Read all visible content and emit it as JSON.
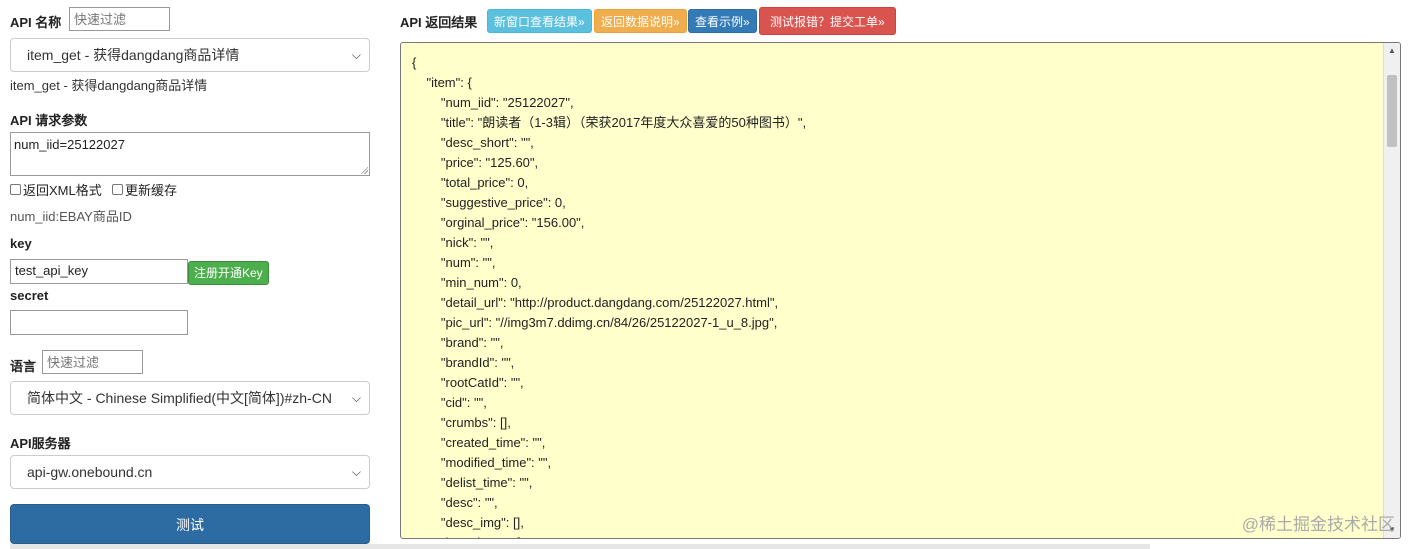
{
  "left": {
    "api_name_label": "API 名称",
    "api_filter_placeholder": "快速过滤",
    "api_selected": "item_get - 获得dangdang商品详情",
    "api_desc": "item_get - 获得dangdang商品详情",
    "params_label": "API 请求参数",
    "params_value": "num_iid=25122027",
    "xml_label": "返回XML格式",
    "cache_label": "更新缓存",
    "param_hint": "num_iid:EBAY商品ID",
    "key_label": "key",
    "key_value": "test_api_key",
    "register_button": "注册开通Key",
    "secret_label": "secret",
    "secret_value": "",
    "lang_label": "语言",
    "lang_filter_placeholder": "快速过滤",
    "lang_selected": "简体中文 - Chinese Simplified(中文[简体])#zh-CN",
    "server_label": "API服务器",
    "server_selected": "api-gw.onebound.cn",
    "test_button": "测试"
  },
  "right": {
    "title": "API 返回结果",
    "buttons": [
      {
        "label": "新窗口查看结果»",
        "color": "#5bc0de"
      },
      {
        "label": "返回数据说明»",
        "color": "#f0ad4e"
      },
      {
        "label": "查看示例»",
        "color": "#337ab7"
      },
      {
        "label": "测试报错？提交工单»",
        "color": "#d9534f"
      }
    ],
    "result_text": "{\n\t\"item\": {\n\t\t\"num_iid\": \"25122027\",\n\t\t\"title\": \"朗读者（1-3辑）（荣获2017年度大众喜爱的50种图书）\",\n\t\t\"desc_short\": \"\",\n\t\t\"price\": \"125.60\",\n\t\t\"total_price\": 0,\n\t\t\"suggestive_price\": 0,\n\t\t\"orginal_price\": \"156.00\",\n\t\t\"nick\": \"\",\n\t\t\"num\": \"\",\n\t\t\"min_num\": 0,\n\t\t\"detail_url\": \"http://product.dangdang.com/25122027.html\",\n\t\t\"pic_url\": \"//img3m7.ddimg.cn/84/26/25122027-1_u_8.jpg\",\n\t\t\"brand\": \"\",\n\t\t\"brandId\": \"\",\n\t\t\"rootCatId\": \"\",\n\t\t\"cid\": \"\",\n\t\t\"crumbs\": [],\n\t\t\"created_time\": \"\",\n\t\t\"modified_time\": \"\",\n\t\t\"delist_time\": \"\",\n\t\t\"desc\": \"\",\n\t\t\"desc_img\": [],\n\t\t\"item_imgs\": ["
  },
  "watermark": "@稀土掘金技术社区"
}
